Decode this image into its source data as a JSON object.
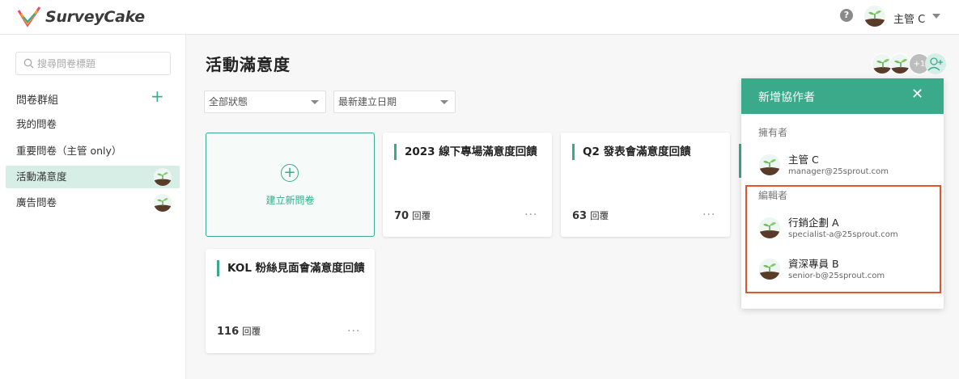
{
  "header": {
    "logo_text": "SurveyCake",
    "help_label": "?",
    "user_name": "主管 C"
  },
  "sidebar": {
    "search_placeholder": "搜尋問卷標題",
    "group_title": "問卷群組",
    "add_label": "+",
    "items": [
      {
        "label": "我的問卷"
      },
      {
        "label": "重要問卷（主管 only）"
      },
      {
        "label": "活動滿意度"
      },
      {
        "label": "廣告問卷"
      }
    ]
  },
  "main": {
    "title": "活動滿意度",
    "filters": {
      "status": "全部狀態",
      "sort": "最新建立日期"
    },
    "new_survey_label": "建立新問卷",
    "new_survey_plus": "+",
    "more_label": "···",
    "cards": [
      {
        "title": "2023 線下專場滿意度回饋",
        "count": "70",
        "unit": "回覆"
      },
      {
        "title": "Q2 發表會滿意度回饋",
        "count": "63",
        "unit": "回覆"
      },
      {
        "title": "KOL 粉絲見面會滿意度回饋",
        "count": "116",
        "unit": "回覆"
      }
    ],
    "collab_extra": "+1"
  },
  "panel": {
    "title": "新增協作者",
    "close": "✕",
    "owner_label": "擁有者",
    "editor_label": "編輯者",
    "owner": {
      "name": "主管 C",
      "email": "manager@25sprout.com"
    },
    "editors": [
      {
        "name": "行銷企劃 A",
        "email": "specialist-a@25sprout.com"
      },
      {
        "name": "資深專員 B",
        "email": "senior-b@25sprout.com"
      }
    ]
  },
  "colors": {
    "accent": "#3aaa8a",
    "highlight": "#e0552b"
  }
}
